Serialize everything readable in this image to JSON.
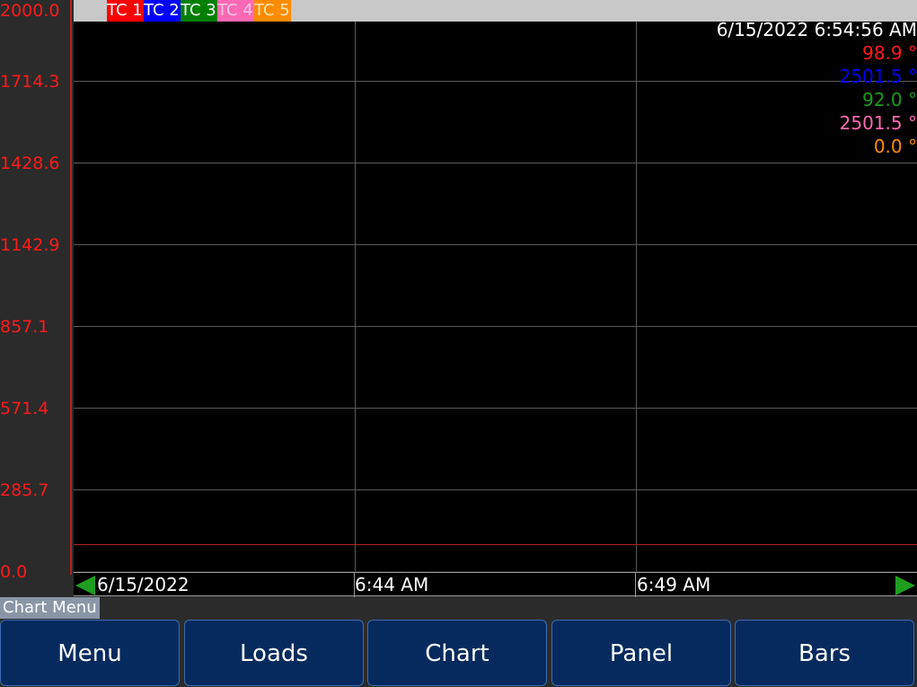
{
  "y_axis": {
    "ticks": [
      "2000.0",
      "1714.3",
      "1428.6",
      "1142.9",
      "857.1",
      "571.4",
      "285.7",
      "0.0"
    ],
    "color": "#ff1a1a"
  },
  "legend": [
    {
      "label": "TC 1",
      "color": "#ff0000"
    },
    {
      "label": "TC 2",
      "color": "#0000ff"
    },
    {
      "label": "TC 3",
      "color": "#008000"
    },
    {
      "label": "TC 4",
      "color": "#ff69b4"
    },
    {
      "label": "TC 5",
      "color": "#ff8c00"
    }
  ],
  "timestamp": "6/15/2022 6:54:56 AM",
  "readings": [
    {
      "value": "98.9 °",
      "color": "#ff1a1a"
    },
    {
      "value": "2501.5 °",
      "color": "#0000ff"
    },
    {
      "value": "92.0 °",
      "color": "#1a9c1a"
    },
    {
      "value": "2501.5 °",
      "color": "#ff69b4"
    },
    {
      "value": "0.0 °",
      "color": "#ff8c00"
    }
  ],
  "x_axis": {
    "date": "6/15/2022",
    "labels": [
      "6:44 AM",
      "6:49 AM"
    ]
  },
  "chart_menu_label": "Chart Menu",
  "buttons": [
    "Menu",
    "Loads",
    "Chart",
    "Panel",
    "Bars"
  ]
}
